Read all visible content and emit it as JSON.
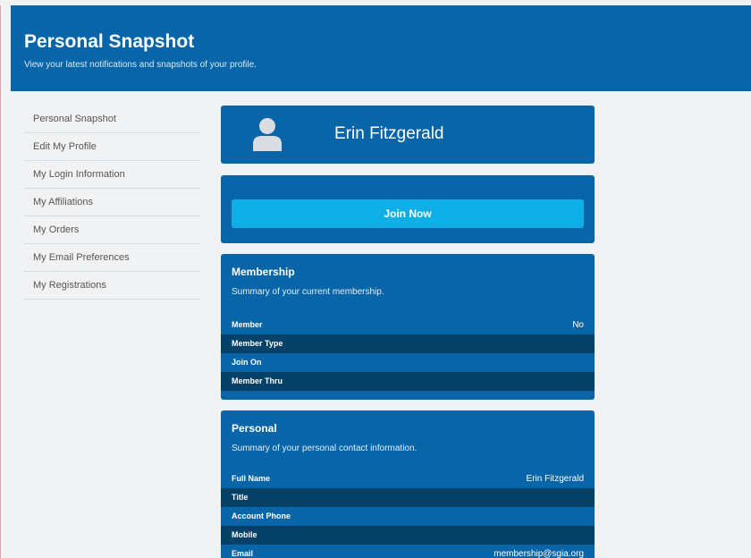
{
  "header": {
    "title": "Personal Snapshot",
    "subtitle": "View your latest notifications and snapshots of your profile."
  },
  "sidebar": {
    "items": [
      {
        "label": "Personal Snapshot"
      },
      {
        "label": "Edit My Profile"
      },
      {
        "label": "My Login Information"
      },
      {
        "label": "My Affiliations"
      },
      {
        "label": "My Orders"
      },
      {
        "label": "My Email Preferences"
      },
      {
        "label": "My Registrations"
      }
    ]
  },
  "profile": {
    "name": "Erin Fitzgerald",
    "avatar_icon": "user-silhouette-icon"
  },
  "join": {
    "button_label": "Join Now"
  },
  "membership": {
    "title": "Membership",
    "subtitle": "Summary of your current membership.",
    "rows": [
      {
        "label": "Member",
        "value": "No"
      },
      {
        "label": "Member Type",
        "value": ""
      },
      {
        "label": "Join On",
        "value": ""
      },
      {
        "label": "Member Thru",
        "value": ""
      }
    ]
  },
  "personal": {
    "title": "Personal",
    "subtitle": "Summary of your personal contact information.",
    "rows": [
      {
        "label": "Full Name",
        "value": "Erin Fitzgerald"
      },
      {
        "label": "Title",
        "value": ""
      },
      {
        "label": "Account Phone",
        "value": ""
      },
      {
        "label": "Mobile",
        "value": ""
      },
      {
        "label": "Email",
        "value": "membership@sgia.org"
      }
    ]
  },
  "colors": {
    "primary": "#0765a8",
    "row_alt": "#054168",
    "button": "#0eaee6",
    "page_bg": "#f1f2f4"
  }
}
